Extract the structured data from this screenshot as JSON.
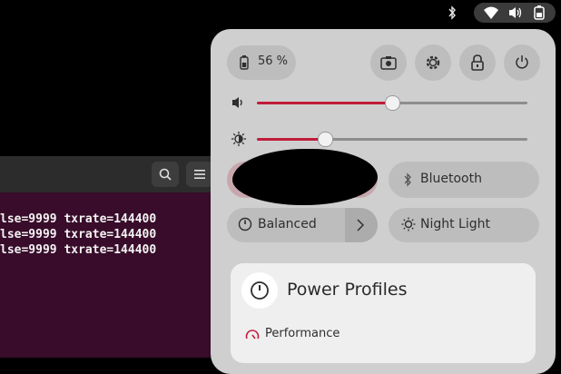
{
  "topbar": {
    "icons": [
      "bluetooth-icon",
      "wifi-icon",
      "volume-icon",
      "battery-icon"
    ]
  },
  "terminal": {
    "lines": [
      "lse=9999 txrate=144400",
      "lse=9999 txrate=144400",
      "lse=9999 txrate=144400"
    ],
    "header_icons": [
      "search-icon",
      "menu-icon"
    ]
  },
  "quick_settings": {
    "battery_label": "56 %",
    "action_icons": [
      "screenshot-icon",
      "settings-icon",
      "lock-icon",
      "power-icon"
    ],
    "volume_level": 0.5,
    "brightness_level": 0.25,
    "toggles": {
      "bluetooth": "Bluetooth",
      "power_mode": "Balanced",
      "night_light": "Night Light"
    },
    "submenu": {
      "title": "Power Profiles",
      "first_item": "Performance"
    },
    "colors": {
      "accent": "#c01c3a",
      "panel": "#cfcfcf",
      "pill": "#bdbdbd"
    }
  }
}
